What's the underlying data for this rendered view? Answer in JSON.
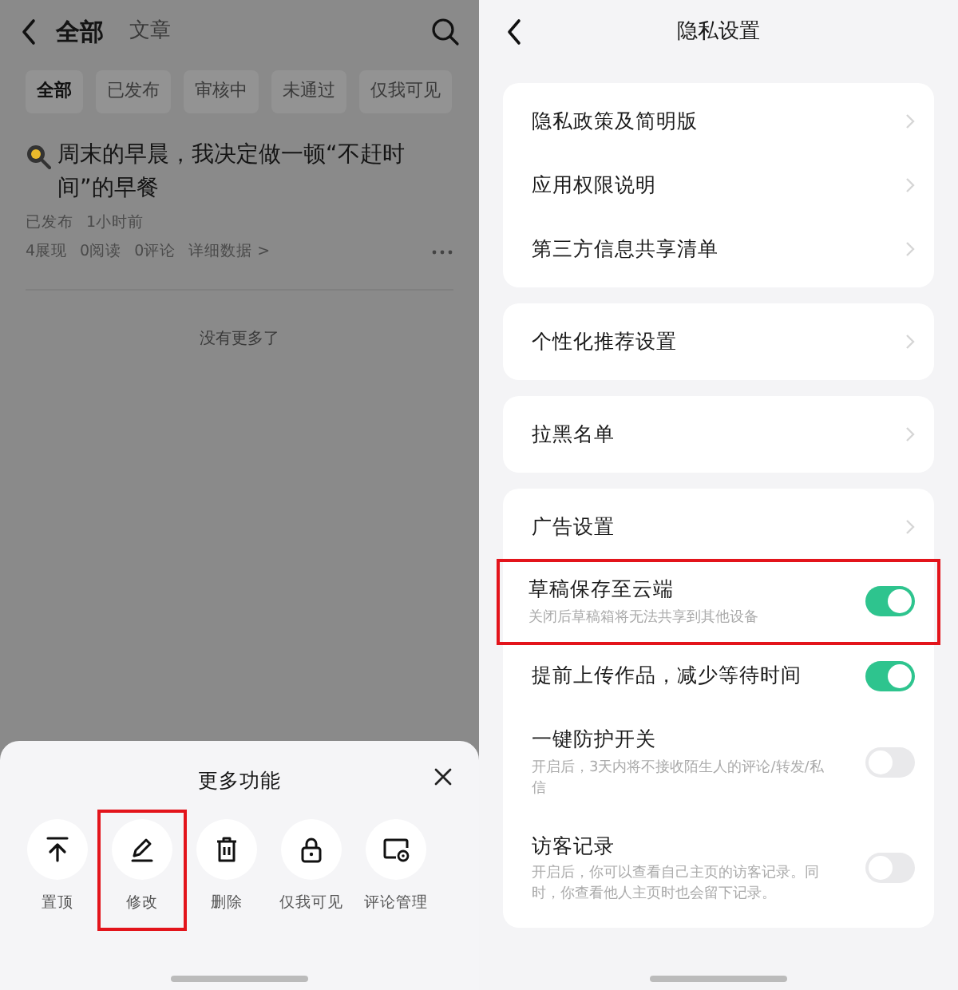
{
  "left": {
    "header": {
      "title": "全部",
      "subtitle": "文章"
    },
    "filter_tabs": [
      {
        "label": "全部",
        "selected": true
      },
      {
        "label": "已发布",
        "selected": false
      },
      {
        "label": "审核中",
        "selected": false
      },
      {
        "label": "未通过",
        "selected": false
      },
      {
        "label": "仅我可见",
        "selected": false
      }
    ],
    "article": {
      "title": "周末的早晨，我决定做一顿“不赶时间”的早餐",
      "status": "已发布",
      "time": "1小时前",
      "stats": [
        "4展现",
        "0阅读",
        "0评论"
      ],
      "details_link": "详细数据 >"
    },
    "end_text": "没有更多了",
    "sheet": {
      "title": "更多功能",
      "actions": [
        {
          "kind": "pin",
          "label": "置顶",
          "highlighted": false
        },
        {
          "kind": "edit",
          "label": "修改",
          "highlighted": true
        },
        {
          "kind": "delete",
          "label": "删除",
          "highlighted": false
        },
        {
          "kind": "private",
          "label": "仅我可见",
          "highlighted": false
        },
        {
          "kind": "comments",
          "label": "评论管理",
          "highlighted": false
        }
      ]
    }
  },
  "right": {
    "title": "隐私设置",
    "groups": [
      {
        "items": [
          {
            "kind": "link",
            "label": "隐私政策及简明版"
          },
          {
            "kind": "link",
            "label": "应用权限说明"
          },
          {
            "kind": "link",
            "label": "第三方信息共享清单"
          }
        ]
      },
      {
        "items": [
          {
            "kind": "link",
            "label": "个性化推荐设置"
          }
        ]
      },
      {
        "items": [
          {
            "kind": "link",
            "label": "拉黑名单"
          }
        ]
      },
      {
        "items": [
          {
            "kind": "link",
            "label": "广告设置"
          },
          {
            "kind": "toggle",
            "label": "草稿保存至云端",
            "description": "关闭后草稿箱将无法共享到其他设备",
            "on": true,
            "highlighted": true
          },
          {
            "kind": "toggle",
            "label": "提前上传作品，减少等待时间",
            "on": true,
            "highlighted": false
          },
          {
            "kind": "toggle",
            "label": "一键防护开关",
            "description": "开启后，3天内将不接收陌生人的评论/转发/私信",
            "on": false,
            "highlighted": false
          },
          {
            "kind": "toggle",
            "label": "访客记录",
            "description": "开启后，你可以查看自己主页的访客记录。同时，你查看他人主页时也会留下记录。",
            "on": false,
            "highlighted": false
          }
        ]
      }
    ]
  }
}
